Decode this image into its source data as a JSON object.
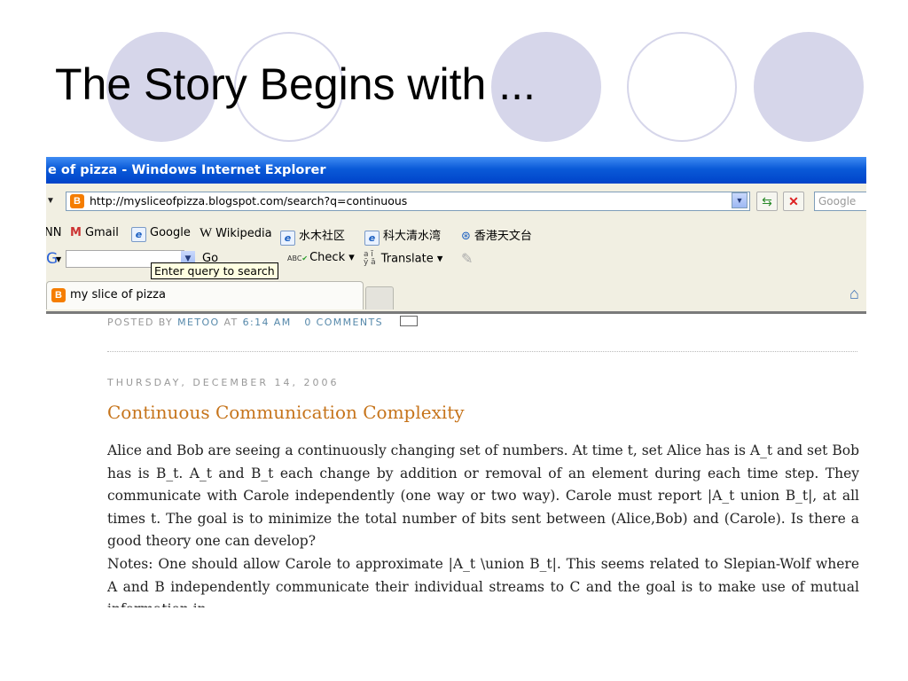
{
  "slide": {
    "title": "The Story Begins with ..."
  },
  "browser": {
    "window_title": "e of pizza - Windows Internet Explorer",
    "address_url": "http://mysliceofpizza.blogspot.com/search?q=continuous",
    "search_placeholder": "Google",
    "links": [
      {
        "label": "NN",
        "icon": "link-icon"
      },
      {
        "label": "Gmail",
        "icon": "gmail-icon"
      },
      {
        "label": "Google",
        "icon": "ie-page-icon"
      },
      {
        "label": "Wikipedia",
        "icon": "wikipedia-icon"
      },
      {
        "label": "水木社区",
        "icon": "ie-page-icon"
      },
      {
        "label": "科大清水湾",
        "icon": "ie-page-icon"
      },
      {
        "label": "香港天文台",
        "icon": "observatory-icon"
      }
    ],
    "toolbar": {
      "go_label": "Go",
      "check_label": "Check",
      "translate_label": "Translate",
      "tooltip": "Enter query to search"
    },
    "tab_label": "my slice of pizza"
  },
  "blog": {
    "post_meta": {
      "posted_by": "POSTED BY",
      "author": "METOO",
      "at": "AT",
      "time": "6:14 AM",
      "comments": "0 COMMENTS"
    },
    "date_header": "THURSDAY, DECEMBER 14, 2006",
    "post_title": "Continuous Communication Complexity",
    "paragraphs": [
      "Alice and Bob are seeing a continuously changing set of numbers. At time t, set Alice has is A_t and set Bob has is B_t. A_t and B_t each change by addition or removal of an element during each time step. They communicate with Carole independently (one way or two way). Carole must report |A_t union B_t|, at all times t. The goal is to minimize the total number of bits sent between (Alice,Bob) and (Carole). Is there a good theory one can develop?",
      "Notes: One should allow Carole to approximate |A_t \\union B_t|. This seems related to Slepian-Wolf where A and B independently communicate their individual streams to C and the goal is to make use of mutual information in"
    ]
  },
  "colors": {
    "circle": "#d6d6ea",
    "titlebar": "#0a5ad8",
    "post_title": "#c6741b"
  }
}
